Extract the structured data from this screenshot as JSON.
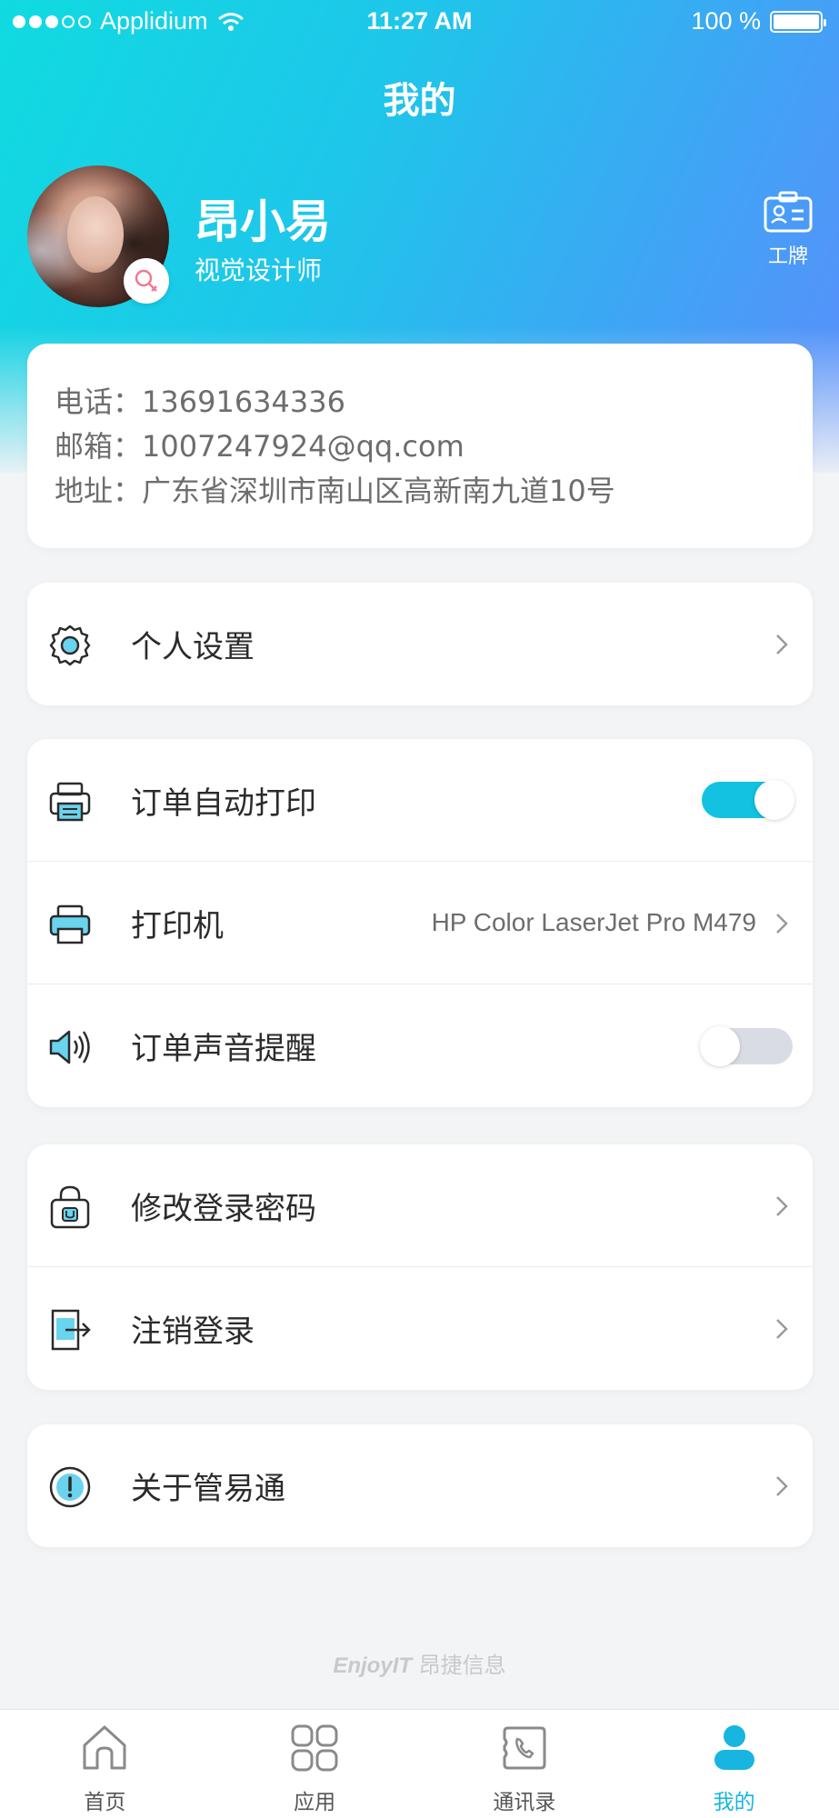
{
  "status_bar": {
    "carrier": "Applidium",
    "time": "11:27 AM",
    "battery": "100 %"
  },
  "header": {
    "title": "我的"
  },
  "profile": {
    "name": "昂小易",
    "role": "视觉设计师",
    "badge_label": "工牌"
  },
  "info": {
    "phone_label": "电话：",
    "phone": "13691634336",
    "email_label": "邮箱：",
    "email": "1007247924@qq.com",
    "address_label": "地址：",
    "address": "广东省深圳市南山区高新南九道10号"
  },
  "settings": {
    "personal_settings": "个人设置",
    "auto_print": "订单自动打印",
    "auto_print_on": true,
    "printer": "打印机",
    "printer_value": "HP Color LaserJet Pro M479",
    "sound_alert": "订单声音提醒",
    "sound_alert_on": false,
    "change_password": "修改登录密码",
    "logout": "注销登录",
    "about": "关于管易通"
  },
  "footer": {
    "brand_en": "EnjoyIT",
    "brand_cn": " 昂捷信息"
  },
  "tabbar": {
    "tabs": [
      {
        "label": "首页",
        "icon": "home-icon"
      },
      {
        "label": "应用",
        "icon": "apps-icon"
      },
      {
        "label": "通讯录",
        "icon": "contacts-icon"
      },
      {
        "label": "我的",
        "icon": "profile-icon"
      }
    ],
    "active_index": 3
  },
  "colors": {
    "accent": "#13c1e0",
    "gradient_start": "#10dbe0",
    "gradient_end": "#5b8dfb",
    "toggle_off": "#d9dce3"
  }
}
